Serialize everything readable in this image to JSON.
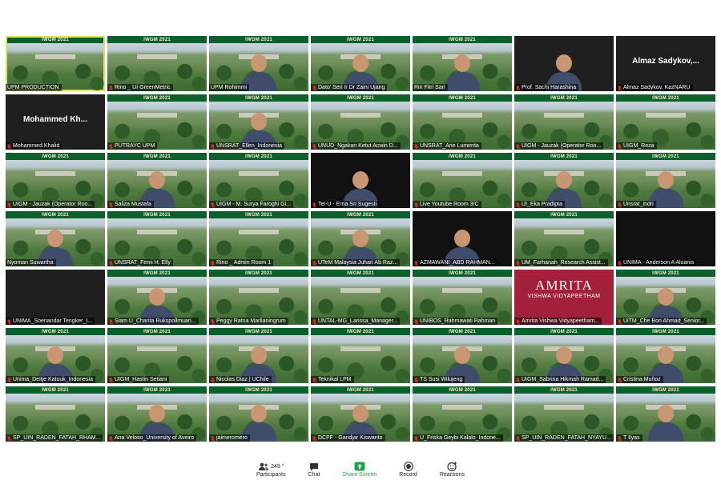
{
  "participants_grid": [
    {
      "name": "UPM PRODUCTION",
      "bg": "landscape",
      "selected": true,
      "mic": false
    },
    {
      "name": "Rino _ UI GreenMetric",
      "bg": "landscape",
      "mic": true
    },
    {
      "name": "UPM Rohimmi",
      "bg": "landscape",
      "person": true,
      "mic": false
    },
    {
      "name": "Dato' Seri Ir Dr Zaini Ujang",
      "bg": "landscape",
      "person": true,
      "mic": true
    },
    {
      "name": "Riri Fitri Sari",
      "bg": "landscape",
      "person": true,
      "mic": false
    },
    {
      "name": "Prof. Sachi Harashina",
      "bg": "dark",
      "person": true,
      "mic": true
    },
    {
      "name": "Almaz Sadykov, KazNARU",
      "bg": "dark",
      "center_name": "Almaz Sadykov,...",
      "mic": true
    },
    {
      "name": "Mohammed Khalid",
      "bg": "dark",
      "center_name": "Mohammed Kh...",
      "mic": true
    },
    {
      "name": "PUTRAYC UPM",
      "bg": "landscape",
      "mic": true
    },
    {
      "name": "UNSRAT_Ellen_Indonesia",
      "bg": "landscape",
      "person": true,
      "mic": true
    },
    {
      "name": "UNUD_Ngakan Ketut Acwin D...",
      "bg": "landscape",
      "mic": true
    },
    {
      "name": "UNSRAT_Arie Lumenta",
      "bg": "landscape",
      "mic": true
    },
    {
      "name": "UIGM - Jauzak (Operator Roo...",
      "bg": "landscape",
      "mic": true
    },
    {
      "name": "UIGM_Reza",
      "bg": "landscape",
      "mic": true
    },
    {
      "name": "UIGM - Jauzak (Operator Roo...",
      "bg": "landscape",
      "mic": true
    },
    {
      "name": "Saliza Mustafa",
      "bg": "landscape",
      "person": true,
      "mic": true
    },
    {
      "name": "UIGM - M. Surya Faroghi Gi...",
      "bg": "landscape",
      "mic": true
    },
    {
      "name": "Tel-U - Erna Sri Sugesti",
      "bg": "black",
      "person": true,
      "mic": true
    },
    {
      "name": "Live Youtube Room 3/C",
      "bg": "landscape",
      "mic": true
    },
    {
      "name": "UI_Eka Pradipta",
      "bg": "landscape",
      "person": true,
      "mic": true
    },
    {
      "name": "Unsrat_indri",
      "bg": "landscape",
      "person": true,
      "mic": true
    },
    {
      "name": "Nyoman Suwartha",
      "bg": "landscape",
      "person": true,
      "mic": false
    },
    {
      "name": "UNSRAT_Femi H. Elly",
      "bg": "landscape",
      "mic": true
    },
    {
      "name": "Rino _ Admin Room 1",
      "bg": "landscape",
      "mic": true
    },
    {
      "name": "UTeM Malaysia Juhari Ab Raz...",
      "bg": "landscape",
      "person": true,
      "mic": true
    },
    {
      "name": "AZMAWANI_ABD RAHMAN...",
      "bg": "black",
      "person": true,
      "mic": true
    },
    {
      "name": "UM_Farhanah_Research Assist...",
      "bg": "landscape",
      "mic": true
    },
    {
      "name": "UNIMA - Anderson A Aloanis",
      "bg": "black",
      "mic": true
    },
    {
      "name": "UNIMA_Soenandar Tengker_I...",
      "bg": "dark",
      "mic": true
    },
    {
      "name": "Siam U_Charita Rukspollmuan...",
      "bg": "landscape",
      "person": true,
      "mic": true
    },
    {
      "name": "Peggy Ratna Marlianingrum",
      "bg": "landscape",
      "mic": true
    },
    {
      "name": "UNTAL-MG_Larissa_Manager...",
      "bg": "landscape",
      "mic": true
    },
    {
      "name": "UNIBOS_Rahmawati Rahman",
      "bg": "landscape",
      "mic": true
    },
    {
      "name": "Amrita Vishwa Vidyapeetham...",
      "bg": "amrita",
      "logo_big": "AMRITA",
      "logo_small": "VISHWA VIDYAPEETHAM",
      "mic": true
    },
    {
      "name": "UiTM_Che Bon Ahmad_Senior...",
      "bg": "landscape",
      "person": true,
      "mic": true
    },
    {
      "name": "Unima_Deitje Katuuk_Indonesia",
      "bg": "landscape",
      "person": true,
      "mic": true
    },
    {
      "name": "UIGM_Hastin Setiani",
      "bg": "landscape",
      "mic": true
    },
    {
      "name": "Nicolas Diaz | UChile",
      "bg": "landscape",
      "person": true,
      "mic": true
    },
    {
      "name": "Teknikal LPM",
      "bg": "landscape",
      "mic": true
    },
    {
      "name": "TS Susi Wilujeng",
      "bg": "landscape",
      "person": true,
      "mic": true
    },
    {
      "name": "UIGM_Sabrina Hikmah Ramad...",
      "bg": "landscape",
      "person": true,
      "mic": true
    },
    {
      "name": "Cristina Muñoz",
      "bg": "landscape",
      "person": true,
      "mic": true
    },
    {
      "name": "SP_UIN_RADEN_FATAH_RHAM...",
      "bg": "landscape",
      "mic": true
    },
    {
      "name": "Ana Veloso_University of Aveiro",
      "bg": "landscape",
      "person": true,
      "mic": true
    },
    {
      "name": "jaimeromero",
      "bg": "landscape",
      "person": true,
      "mic": true
    },
    {
      "name": "DCPF - Gandjar Kiswanto",
      "bg": "landscape",
      "person": true,
      "mic": true
    },
    {
      "name": "U_Friska Geybi Kalalo_Indone...",
      "bg": "landscape",
      "mic": true
    },
    {
      "name": "SP_UIN_RADEN_FATAH_NYAYU...",
      "bg": "landscape",
      "mic": true
    },
    {
      "name": "T Ilyas",
      "bg": "landscape",
      "person": true,
      "mic": true
    }
  ],
  "banner_text": "IWGM 2021",
  "toolbar": {
    "participants_label": "Participants",
    "participants_count": "249",
    "chat_label": "Chat",
    "share_label": "Share Screen",
    "record_label": "Record",
    "reactions_label": "Reactions"
  },
  "colors": {
    "share_green": "#1aa34a",
    "muted_red": "#e0302c",
    "amrita": "#a3203b",
    "selected_outline": "#d6e55d"
  }
}
